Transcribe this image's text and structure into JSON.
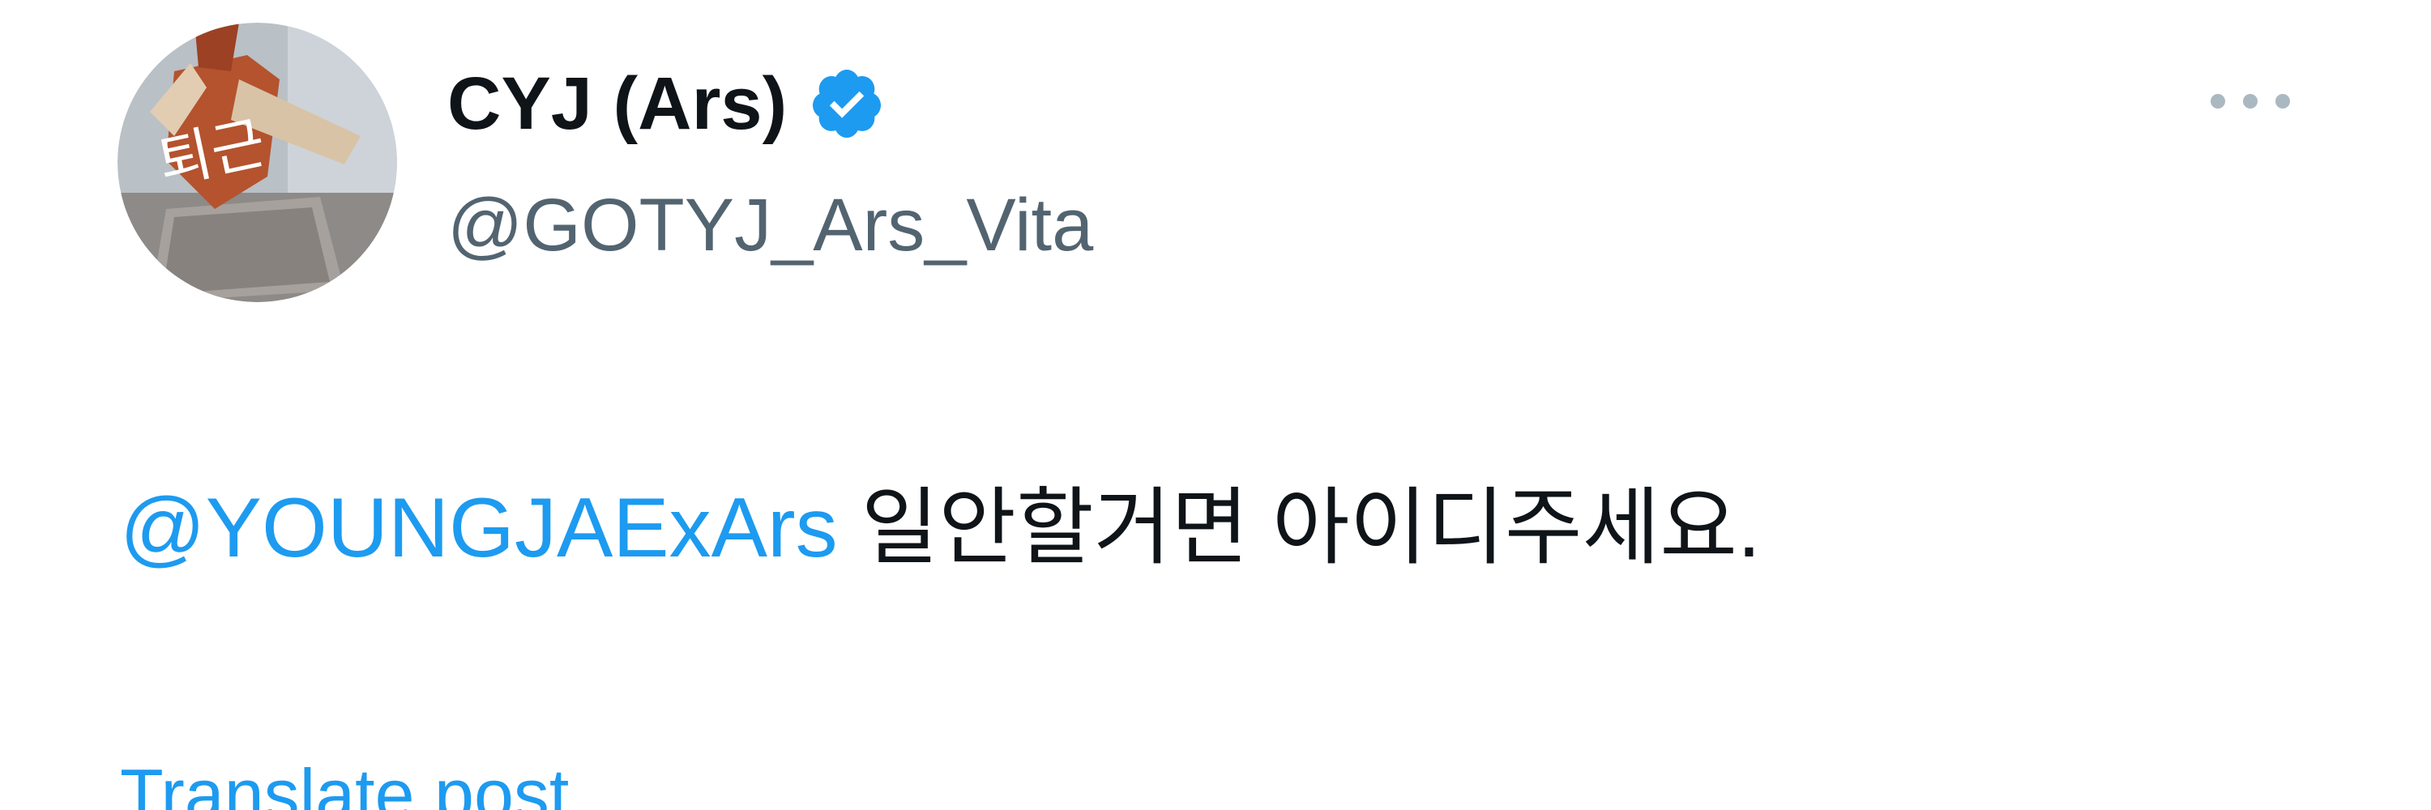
{
  "author": {
    "display_name": "CYJ (Ars)",
    "handle": "@GOTYJ_Ars_Vita",
    "verified": true,
    "avatar_overlay_text": "퇴근"
  },
  "post": {
    "mention": "@YOUNGJAExArs",
    "text": " 일안할거면 아이디주세요."
  },
  "actions": {
    "translate_label": "Translate post",
    "more_icon": "more-horizontal-icon"
  },
  "colors": {
    "link": "#1d9bf0",
    "verified": "#1d9bf0",
    "secondary_text": "#536471",
    "primary_text": "#0f1419"
  }
}
